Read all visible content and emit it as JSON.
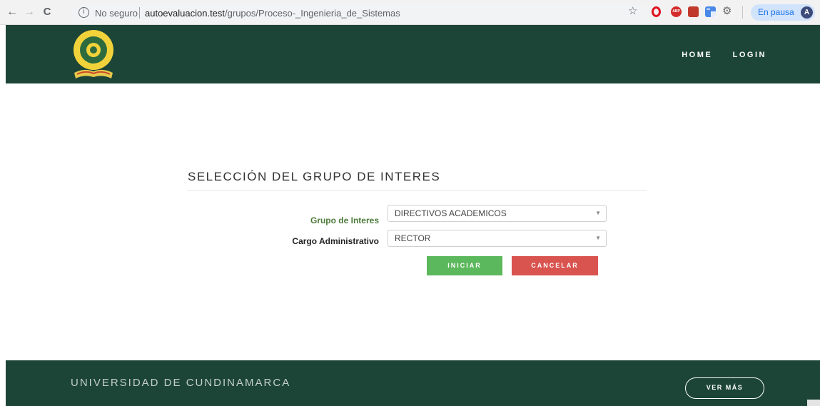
{
  "browser": {
    "nav": {
      "back_icon": "←",
      "forward_icon": "→",
      "reload_icon": "C"
    },
    "info_icon": "i",
    "security_text": "No seguro",
    "url_host": "autoevaluacion.test",
    "url_path": "/grupos/Proceso-_Ingenieria_de_Sistemas",
    "bookmark_icon": "☆",
    "extensions": [
      "opera-icon",
      "adblock-plus-icon",
      "red-extension-icon",
      "google-translate-icon",
      "gear-icon"
    ],
    "abp_label": "ABP",
    "profile_status": "En pausa",
    "profile_initial": "A"
  },
  "header": {
    "logo": "universidad-de-cundinamarca-seal",
    "logo_text": "UNIVERSIDAD DE CUNDINAMARCA",
    "nav": [
      "HOME",
      "LOGIN"
    ]
  },
  "form": {
    "title": "SELECCIÓN DEL GRUPO DE INTERES",
    "group_label": "Grupo de Interes",
    "group_value": "DIRECTIVOS ACADEMICOS",
    "cargo_label": "Cargo Administrativo",
    "cargo_value": "RECTOR",
    "arrow": "▼",
    "start_button": "INICIAR",
    "cancel_button": "CANCELAR"
  },
  "footer": {
    "title": "UNIVERSIDAD DE CUNDINAMARCA",
    "more_button": "VER MÁS"
  },
  "colors": {
    "brand_green": "#1c4537",
    "success": "#5cb85c",
    "danger": "#d9534f",
    "label_green": "#4d7a3a"
  }
}
